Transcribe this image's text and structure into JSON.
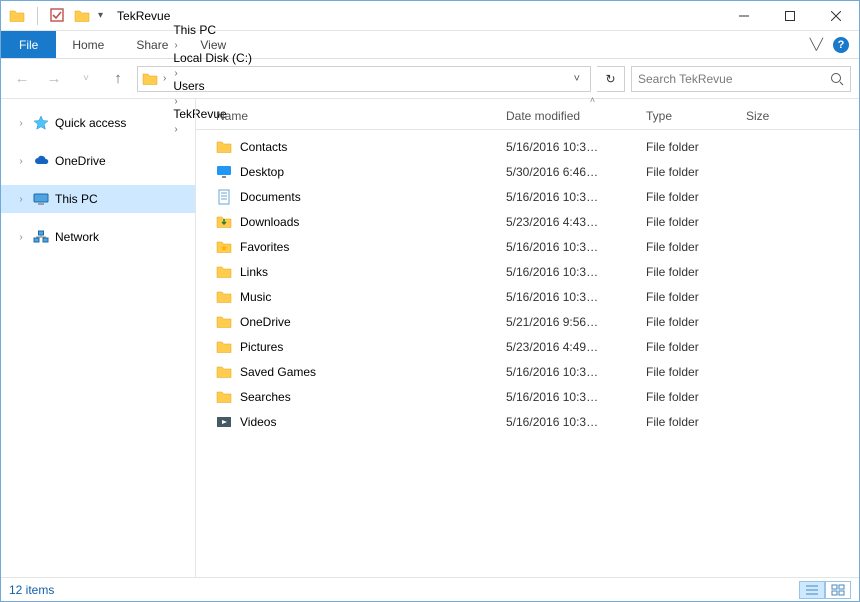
{
  "window": {
    "title": "TekRevue"
  },
  "ribbon": {
    "file": "File",
    "tabs": [
      "Home",
      "Share",
      "View"
    ]
  },
  "breadcrumbs": [
    "This PC",
    "Local Disk (C:)",
    "Users",
    "TekRevue"
  ],
  "search": {
    "placeholder": "Search TekRevue"
  },
  "side": {
    "items": [
      {
        "label": "Quick access",
        "icon": "star",
        "expandable": true,
        "selected": false
      },
      {
        "label": "OneDrive",
        "icon": "cloud",
        "expandable": true,
        "selected": false
      },
      {
        "label": "This PC",
        "icon": "pc",
        "expandable": true,
        "selected": true
      },
      {
        "label": "Network",
        "icon": "net",
        "expandable": true,
        "selected": false
      }
    ]
  },
  "columns": {
    "name": "Name",
    "date": "Date modified",
    "type": "Type",
    "size": "Size"
  },
  "rows": [
    {
      "name": "Contacts",
      "date": "5/16/2016 10:3…",
      "type": "File folder",
      "icon": "folder"
    },
    {
      "name": "Desktop",
      "date": "5/30/2016 6:46…",
      "type": "File folder",
      "icon": "desktop"
    },
    {
      "name": "Documents",
      "date": "5/16/2016 10:3…",
      "type": "File folder",
      "icon": "doc"
    },
    {
      "name": "Downloads",
      "date": "5/23/2016 4:43…",
      "type": "File folder",
      "icon": "download"
    },
    {
      "name": "Favorites",
      "date": "5/16/2016 10:3…",
      "type": "File folder",
      "icon": "fav"
    },
    {
      "name": "Links",
      "date": "5/16/2016 10:3…",
      "type": "File folder",
      "icon": "folder"
    },
    {
      "name": "Music",
      "date": "5/16/2016 10:3…",
      "type": "File folder",
      "icon": "folder"
    },
    {
      "name": "OneDrive",
      "date": "5/21/2016 9:56…",
      "type": "File folder",
      "icon": "folder"
    },
    {
      "name": "Pictures",
      "date": "5/23/2016 4:49…",
      "type": "File folder",
      "icon": "folder"
    },
    {
      "name": "Saved Games",
      "date": "5/16/2016 10:3…",
      "type": "File folder",
      "icon": "folder"
    },
    {
      "name": "Searches",
      "date": "5/16/2016 10:3…",
      "type": "File folder",
      "icon": "folder"
    },
    {
      "name": "Videos",
      "date": "5/16/2016 10:3…",
      "type": "File folder",
      "icon": "video"
    }
  ],
  "status": {
    "count": "12 items"
  }
}
